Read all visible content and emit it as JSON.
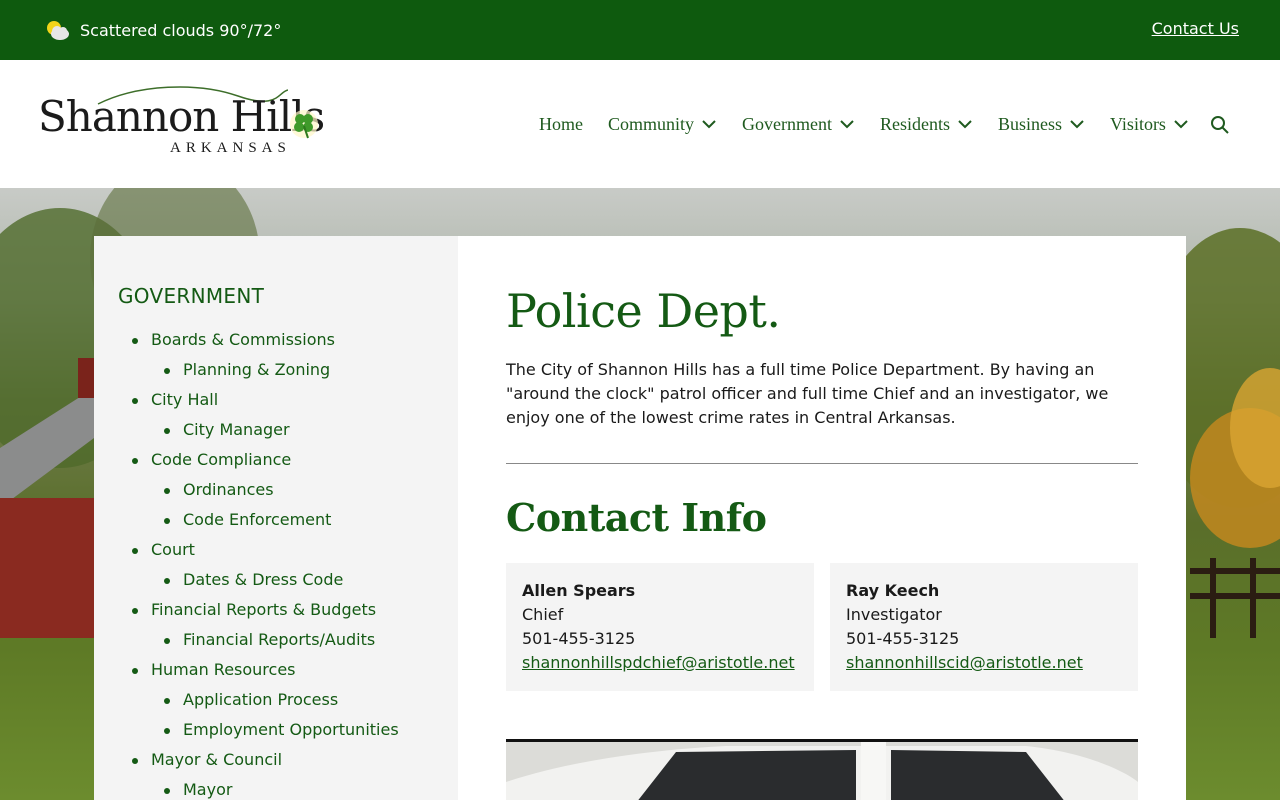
{
  "topbar": {
    "weather_text": "Scattered clouds 90°/72°",
    "contact_label": "Contact Us",
    "background": "#0e5a0e"
  },
  "logo": {
    "main": "Shannon Hills",
    "sub": "ARKANSAS"
  },
  "nav": {
    "items": [
      {
        "label": "Home",
        "has_dropdown": false
      },
      {
        "label": "Community",
        "has_dropdown": true
      },
      {
        "label": "Government",
        "has_dropdown": true
      },
      {
        "label": "Residents",
        "has_dropdown": true
      },
      {
        "label": "Business",
        "has_dropdown": true
      },
      {
        "label": "Visitors",
        "has_dropdown": true
      }
    ],
    "search_icon": "search-icon"
  },
  "sidebar": {
    "title": "GOVERNMENT",
    "items": [
      {
        "label": "Boards & Commissions",
        "level": 1
      },
      {
        "label": "Planning & Zoning",
        "level": 2
      },
      {
        "label": "City Hall",
        "level": 1
      },
      {
        "label": "City Manager",
        "level": 2
      },
      {
        "label": "Code Compliance",
        "level": 1
      },
      {
        "label": "Ordinances",
        "level": 2
      },
      {
        "label": "Code Enforcement",
        "level": 2
      },
      {
        "label": "Court",
        "level": 1
      },
      {
        "label": "Dates & Dress Code",
        "level": 2
      },
      {
        "label": "Financial Reports & Budgets",
        "level": 1
      },
      {
        "label": "Financial Reports/Audits",
        "level": 2
      },
      {
        "label": "Human Resources",
        "level": 1
      },
      {
        "label": "Application Process",
        "level": 2
      },
      {
        "label": "Employment Opportunities",
        "level": 2
      },
      {
        "label": "Mayor & Council",
        "level": 1
      },
      {
        "label": "Mayor",
        "level": 2
      }
    ]
  },
  "main": {
    "title": "Police Dept.",
    "intro": "The City of Shannon Hills has a full time Police Department. By having an \"around the clock\" patrol officer and full time Chief and an investigator, we enjoy one of the lowest crime rates in Central Arkansas.",
    "contact_title": "Contact Info",
    "contacts": [
      {
        "name": "Allen Spears",
        "role": "Chief",
        "phone": "501-455-3125",
        "email": "shannonhillspdchief@aristotle.net"
      },
      {
        "name": "Ray Keech",
        "role": "Investigator",
        "phone": "501-455-3125",
        "email": "shannonhillscid@aristotle.net"
      }
    ]
  },
  "colors": {
    "brand_green": "#145a14",
    "topbar_green": "#0e5a0e",
    "panel_gray": "#f4f4f4"
  }
}
